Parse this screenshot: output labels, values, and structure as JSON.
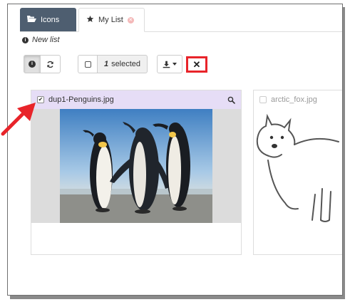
{
  "tabs": [
    {
      "label": "Icons",
      "icon": "folder-open-icon",
      "active": false
    },
    {
      "label": "My List",
      "icon": "star-icon",
      "active": true,
      "closable": true
    }
  ],
  "list": {
    "title": "New list"
  },
  "toolbar": {
    "selected_count": "1",
    "selected_label": "selected",
    "buttons": [
      "info-icon",
      "refresh-icon",
      "select-checkbox",
      "download-icon",
      "remove-icon"
    ]
  },
  "cards": [
    {
      "filename": "dup1-Penguins.jpg",
      "checked": true,
      "image": "penguins-photo"
    },
    {
      "filename": "arctic_fox.jpg",
      "checked": false,
      "image": "arctic-fox-drawing"
    }
  ],
  "colors": {
    "tab_active_bg": "#4e5e70",
    "selected_card_header": "#e6ddf6",
    "highlight_red": "#e8242a"
  }
}
